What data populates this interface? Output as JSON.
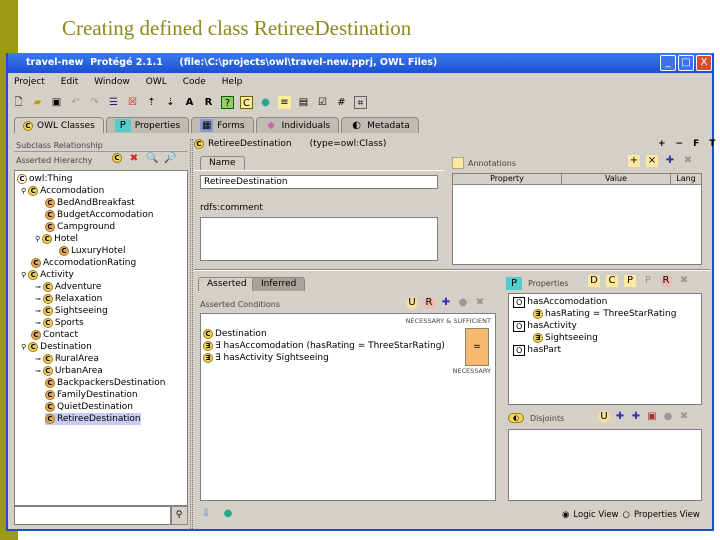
{
  "slide_title": "Creating defined class RetireeDestination",
  "window": {
    "title": "travel-new  Protégé 2.1.1     (file:\\C:\\projects\\owl\\travel-new.pprj, OWL Files)",
    "minimize": "_",
    "maximize": "□",
    "close": "X"
  },
  "menu": [
    "Project",
    "Edit",
    "Window",
    "OWL",
    "Code",
    "Help"
  ],
  "toolbar": [
    "new",
    "open",
    "save",
    "undo",
    "redo",
    "cut",
    "delete",
    "up",
    "down",
    "A",
    "R",
    "check",
    "classify",
    "web",
    "meta",
    "doc",
    "box",
    "grid",
    "tree"
  ],
  "tabs": [
    "OWL Classes",
    "Properties",
    "Forms",
    "Individuals",
    "Metadata"
  ],
  "left": {
    "header": "Subclass Relationship",
    "hierarchy_label": "Asserted Hierarchy",
    "tree": [
      {
        "label": "owl:Thing",
        "depth": 0,
        "expander": ""
      },
      {
        "label": "Accomodation",
        "depth": 1,
        "expander": "open"
      },
      {
        "label": "BedAndBreakfast",
        "depth": 2,
        "expander": ""
      },
      {
        "label": "BudgetAccomodation",
        "depth": 2,
        "expander": ""
      },
      {
        "label": "Campground",
        "depth": 2,
        "expander": ""
      },
      {
        "label": "Hotel",
        "depth": 2,
        "expander": "open"
      },
      {
        "label": "LuxuryHotel",
        "depth": 3,
        "expander": ""
      },
      {
        "label": "AccomodationRating",
        "depth": 1,
        "expander": ""
      },
      {
        "label": "Activity",
        "depth": 1,
        "expander": "open"
      },
      {
        "label": "Adventure",
        "depth": 2,
        "expander": "closed"
      },
      {
        "label": "Relaxation",
        "depth": 2,
        "expander": "closed"
      },
      {
        "label": "Sightseeing",
        "depth": 2,
        "expander": "closed"
      },
      {
        "label": "Sports",
        "depth": 2,
        "expander": "closed"
      },
      {
        "label": "Contact",
        "depth": 1,
        "expander": ""
      },
      {
        "label": "Destination",
        "depth": 1,
        "expander": "open"
      },
      {
        "label": "RuralArea",
        "depth": 2,
        "expander": "closed"
      },
      {
        "label": "UrbanArea",
        "depth": 2,
        "expander": "closed"
      },
      {
        "label": "BackpackersDestination",
        "depth": 2,
        "expander": ""
      },
      {
        "label": "FamilyDestination",
        "depth": 2,
        "expander": ""
      },
      {
        "label": "QuietDestination",
        "depth": 2,
        "expander": ""
      },
      {
        "label": "RetireeDestination",
        "depth": 2,
        "expander": "",
        "selected": true
      }
    ],
    "search_value": ""
  },
  "class_header": {
    "name": "RetireeDestination",
    "type": "(type=owl:Class)",
    "controls": [
      "+",
      "−",
      "F",
      "T"
    ]
  },
  "name_tab": "Name",
  "name_value": "RetireeDestination",
  "comment_label": "rdfs:comment",
  "comment_value": "",
  "annotations": {
    "label": "Annotations",
    "columns": [
      "Property",
      "Value",
      "Lang"
    ]
  },
  "cond_tabs": [
    "Asserted",
    "Inferred"
  ],
  "conditions": {
    "label": "Asserted Conditions",
    "ns_label": "NECESSARY & SUFFICIENT",
    "n_label": "NECESSARY",
    "items": [
      {
        "icon": "C",
        "text": "Destination"
      },
      {
        "icon": "∃",
        "text": "∃ hasAccomodation (hasRating = ThreeStarRating)"
      },
      {
        "icon": "∃",
        "text": "∃ hasActivity Sightseeing"
      }
    ],
    "marker": "="
  },
  "properties": {
    "label": "Properties",
    "items": [
      {
        "text": "hasAccomodation",
        "depth": 0,
        "icon": "O"
      },
      {
        "text": "hasRating = ThreeStarRating",
        "depth": 1,
        "icon": "∃"
      },
      {
        "text": "hasActivity",
        "depth": 0,
        "icon": "O"
      },
      {
        "text": "Sightseeing",
        "depth": 1,
        "icon": "∃"
      },
      {
        "text": "hasPart",
        "depth": 0,
        "icon": "O"
      }
    ]
  },
  "disjoints": {
    "label": "Disjoints"
  },
  "view": {
    "logic": "Logic View",
    "properties": "Properties View",
    "selected": "logic"
  }
}
